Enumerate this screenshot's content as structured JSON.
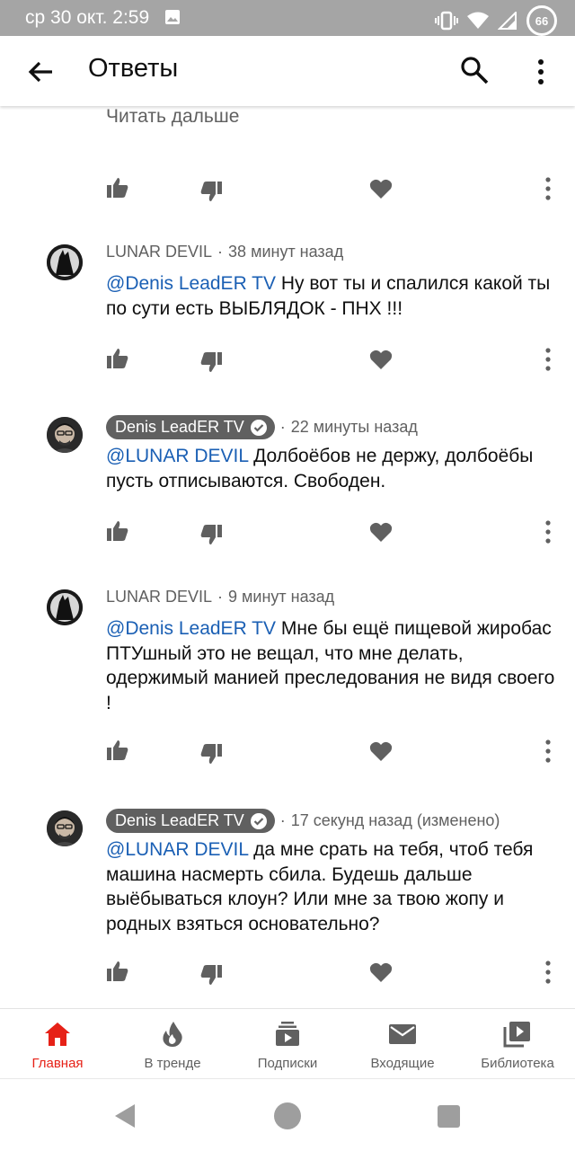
{
  "status_bar": {
    "time": "ср 30 окт. 2:59",
    "battery": "66"
  },
  "app_bar": {
    "title": "Ответы"
  },
  "thread": {
    "read_more": "Читать дальше",
    "comments": [
      {
        "author": "LUNAR DEVIL",
        "verified": false,
        "time": "38 минут назад",
        "mention": "@Denis LeadER TV",
        "text": " Ну вот ты и спалился какой ты по сути есть ВЫБЛЯДОК - ПНХ !!!"
      },
      {
        "author": "Denis LeadER TV",
        "verified": true,
        "time": "22 минуты назад",
        "mention": "@LUNAR DEVIL",
        "text": " Долбоёбов не держу, долбоёбы пусть отписываются. Свободен."
      },
      {
        "author": "LUNAR DEVIL",
        "verified": false,
        "time": "9 минут назад",
        "mention": "@Denis LeadER TV",
        "text": " Мне бы ещё пищевой жиробас ПТУшный это не вещал, что мне делать, одержимый манией преследования не видя своего !"
      },
      {
        "author": "Denis LeadER TV",
        "verified": true,
        "time": "17 секунд назад (изменено)",
        "mention": "@LUNAR DEVIL",
        "text": " да мне срать на тебя,  чтоб тебя машина насмерть сбила. Будешь дальше выёбываться клоун? Или мне за твою жопу и родных взяться основательно?"
      }
    ]
  },
  "bottom_nav": {
    "items": [
      {
        "label": "Главная",
        "icon": "home-icon",
        "active": true
      },
      {
        "label": "В тренде",
        "icon": "trending-icon",
        "active": false
      },
      {
        "label": "Подписки",
        "icon": "subscriptions-icon",
        "active": false
      },
      {
        "label": "Входящие",
        "icon": "inbox-icon",
        "active": false
      },
      {
        "label": "Библиотека",
        "icon": "library-icon",
        "active": false
      }
    ]
  },
  "colors": {
    "accent": "#e62117",
    "mention": "#1a5fb4",
    "secondary_text": "#606060",
    "status_bar": "#a5a5a5"
  }
}
